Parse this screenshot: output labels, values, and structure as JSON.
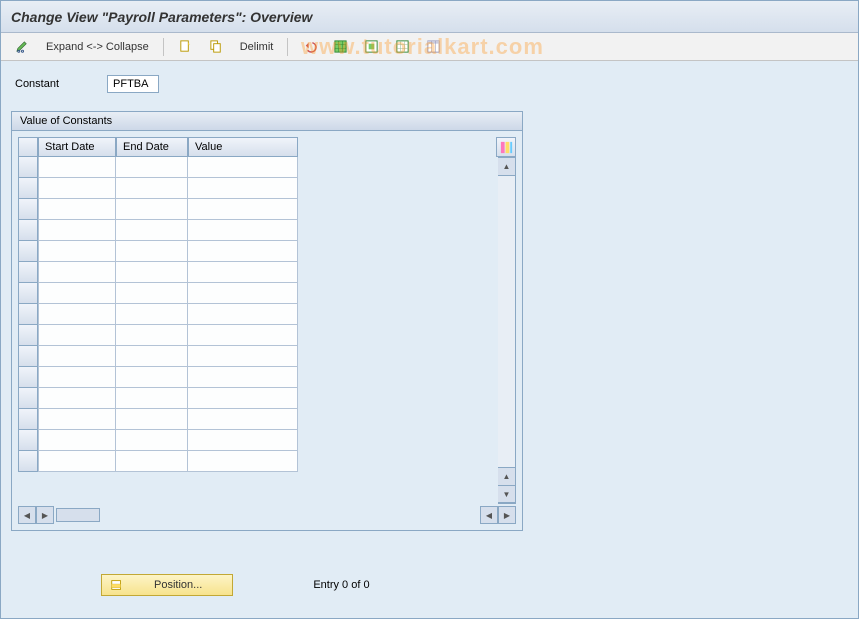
{
  "title": "Change View \"Payroll Parameters\": Overview",
  "toolbar": {
    "expand_collapse_label": "Expand <-> Collapse",
    "delimit_label": "Delimit"
  },
  "field": {
    "label": "Constant",
    "value": "PFTBA"
  },
  "panel": {
    "title": "Value of Constants",
    "columns": {
      "start": "Start Date",
      "end": "End Date",
      "value": "Value"
    },
    "row_count": 15,
    "rows": []
  },
  "footer": {
    "position_label": "Position...",
    "entry_text": "Entry 0 of 0"
  },
  "watermark": "www.tutorialkart.com"
}
